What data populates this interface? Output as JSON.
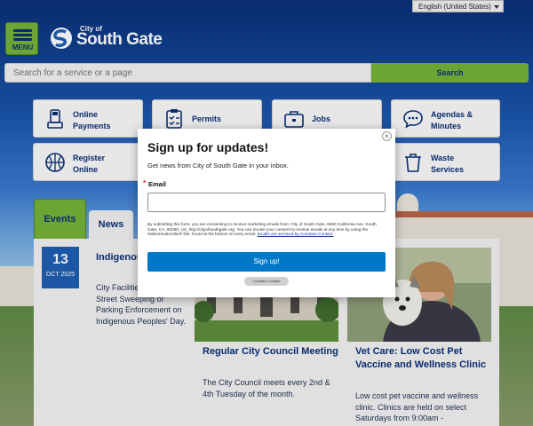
{
  "header": {
    "language": "English (United States)",
    "menu_label": "MENU",
    "logo_small": "City of",
    "logo_big": "South Gate",
    "search_placeholder": "Search for a service or a page",
    "search_button": "Search"
  },
  "tiles": [
    {
      "l1": "Online",
      "l2": "Payments",
      "icon": "payment-terminal-icon"
    },
    {
      "l1": "Permits",
      "l2": "",
      "icon": "clipboard-checklist-icon"
    },
    {
      "l1": "Jobs",
      "l2": "",
      "icon": "briefcase-icon"
    },
    {
      "l1": "Agendas &",
      "l2": "Minutes",
      "icon": "chat-bubble-icon"
    },
    {
      "l1": "Register",
      "l2": "Online",
      "icon": "basketball-icon"
    },
    {
      "l1": "Waste",
      "l2": "Services",
      "icon": "trash-can-icon"
    }
  ],
  "tabs": {
    "events": "Events",
    "news": "News"
  },
  "events": [
    {
      "day": "13",
      "month": "OCT 2025",
      "title": "Indigenous People's Day",
      "text": "City Facilities Closed. No Street Sweeping or Parking Enforcement on Indigenous Peoples' Day."
    },
    {
      "title": "Regular City Council Meeting",
      "text": "The City Council meets every 2nd & 4th Tuesday of the month."
    },
    {
      "title": "Vet Care: Low Cost Pet Vaccine and Wellness Clinic",
      "text": "Low cost pet vaccine and wellness clinic. Clinics are held on select Saturdays from 9:00am -"
    }
  ],
  "modal": {
    "title": "Sign up for updates!",
    "subtitle": "Get news from City of South Gate in your inbox.",
    "required_mark": "*",
    "email_label": "Email",
    "email_value": "",
    "consent": "By submitting this form, you are consenting to receive marketing emails from: City of South Gate, 8650 California Ave, South Gate, CA, 90280, US, http://cityofsouthgate.org. You can revoke your consent to receive emails at any time by using the SafeUnsubscribe® link, found at the bottom of every email.",
    "consent_link": "Emails are serviced by Constant Contact.",
    "submit": "Sign up!",
    "badge": "Constant Contact",
    "close": "×"
  },
  "colors": {
    "navy": "#0a2f78",
    "accent_green": "#77b33a",
    "button_blue": "#0078c8",
    "date_blue": "#1f5fb3"
  }
}
